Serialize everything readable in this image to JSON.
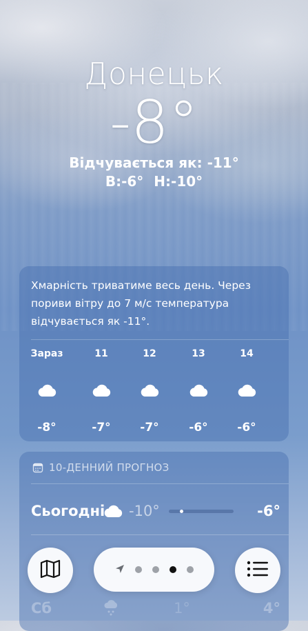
{
  "location": {
    "city": "Донецьк",
    "temperature": "-8°",
    "feels_like": "Відчувається як: -11°",
    "high": "В:-6°",
    "low": "Н:-10°"
  },
  "hourly": {
    "summary": "Хмарність триватиме весь день. Через пориви вітру до 7 м/с температура відчувається як -11°.",
    "items": [
      {
        "label": "Зараз",
        "icon": "cloud-icon",
        "temp": "-8°"
      },
      {
        "label": "11",
        "icon": "cloud-icon",
        "temp": "-7°"
      },
      {
        "label": "12",
        "icon": "cloud-icon",
        "temp": "-7°"
      },
      {
        "label": "13",
        "icon": "cloud-icon",
        "temp": "-6°"
      },
      {
        "label": "14",
        "icon": "cloud-icon",
        "temp": "-6°"
      }
    ]
  },
  "forecast": {
    "header": "10-ДЕННИЙ ПРОГНОЗ",
    "rows": [
      {
        "day": "Сьогодні",
        "icon": "cloud-icon",
        "low": "-10°",
        "high": "-6°",
        "current_position": 0.2
      },
      {
        "day": "Сб",
        "icon": "snow-icon",
        "low": "1°",
        "high": "4°"
      }
    ]
  },
  "toolbar": {
    "map_icon": "map-icon",
    "location_icon": "location-arrow-icon",
    "list_icon": "list-icon",
    "pages": 4,
    "active_page": 3
  },
  "colors": {
    "sky_top": "#c9cfda",
    "sky_mid": "#6f92c6",
    "card": "#466eaf",
    "button_bg": "#ffffff",
    "dot_active": "#111111",
    "dot_inactive": "#9ea2a8"
  }
}
